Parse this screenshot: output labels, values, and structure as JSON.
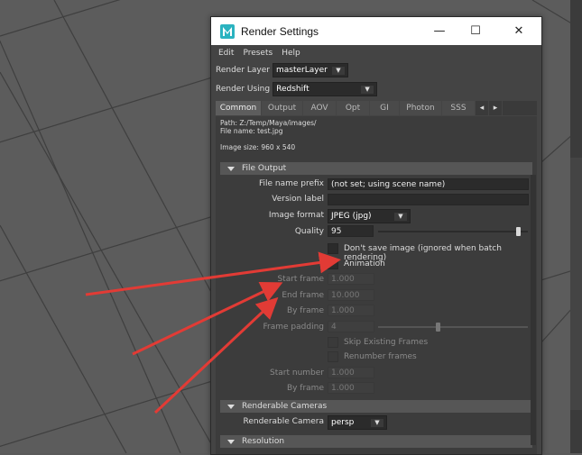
{
  "window": {
    "title": "Render Settings",
    "controls": {
      "minimize": "—",
      "maximize": "☐",
      "close": "✕"
    }
  },
  "menu": [
    "Edit",
    "Presets",
    "Help"
  ],
  "render_layer": {
    "label": "Render Layer",
    "value": "masterLayer"
  },
  "render_using": {
    "label": "Render Using",
    "value": "Redshift"
  },
  "tabs": [
    "Common",
    "Output",
    "AOV",
    "Opt",
    "GI",
    "Photon",
    "SSS"
  ],
  "active_tab": "Common",
  "info": {
    "path": "Path: Z:/Temp/Maya/images/",
    "file_name": "File name:  test.jpg",
    "image_size": "Image size: 960 x 540"
  },
  "file_output": {
    "header": "File Output",
    "prefix": {
      "label": "File name prefix",
      "value": "(not set; using scene name)"
    },
    "version": {
      "label": "Version label",
      "value": ""
    },
    "format": {
      "label": "Image format",
      "value": "JPEG (jpg)"
    },
    "quality": {
      "label": "Quality",
      "value": "95",
      "level": 0.95
    },
    "dont_save": {
      "label": "Don't save image (ignored when batch rendering)"
    },
    "animation": {
      "label": "Animation"
    },
    "start_frame": {
      "label": "Start frame",
      "value": "1.000"
    },
    "end_frame": {
      "label": "End frame",
      "value": "10.000"
    },
    "by_frame": {
      "label": "By frame",
      "value": "1.000"
    },
    "frame_padding": {
      "label": "Frame padding",
      "value": "4",
      "level": 0.4
    },
    "skip_existing": {
      "label": "Skip Existing Frames"
    },
    "renumber": {
      "label": "Renumber frames"
    },
    "start_number": {
      "label": "Start number",
      "value": "1.000"
    },
    "by_number": {
      "label": "By frame",
      "value": "1.000"
    }
  },
  "renderable_cameras": {
    "header": "Renderable Cameras",
    "camera": {
      "label": "Renderable Camera",
      "value": "persp"
    }
  },
  "resolution": {
    "header": "Resolution"
  },
  "colors": {
    "annotation_arrow": "#e23b35",
    "maya_logo": "#2bb3c0"
  }
}
